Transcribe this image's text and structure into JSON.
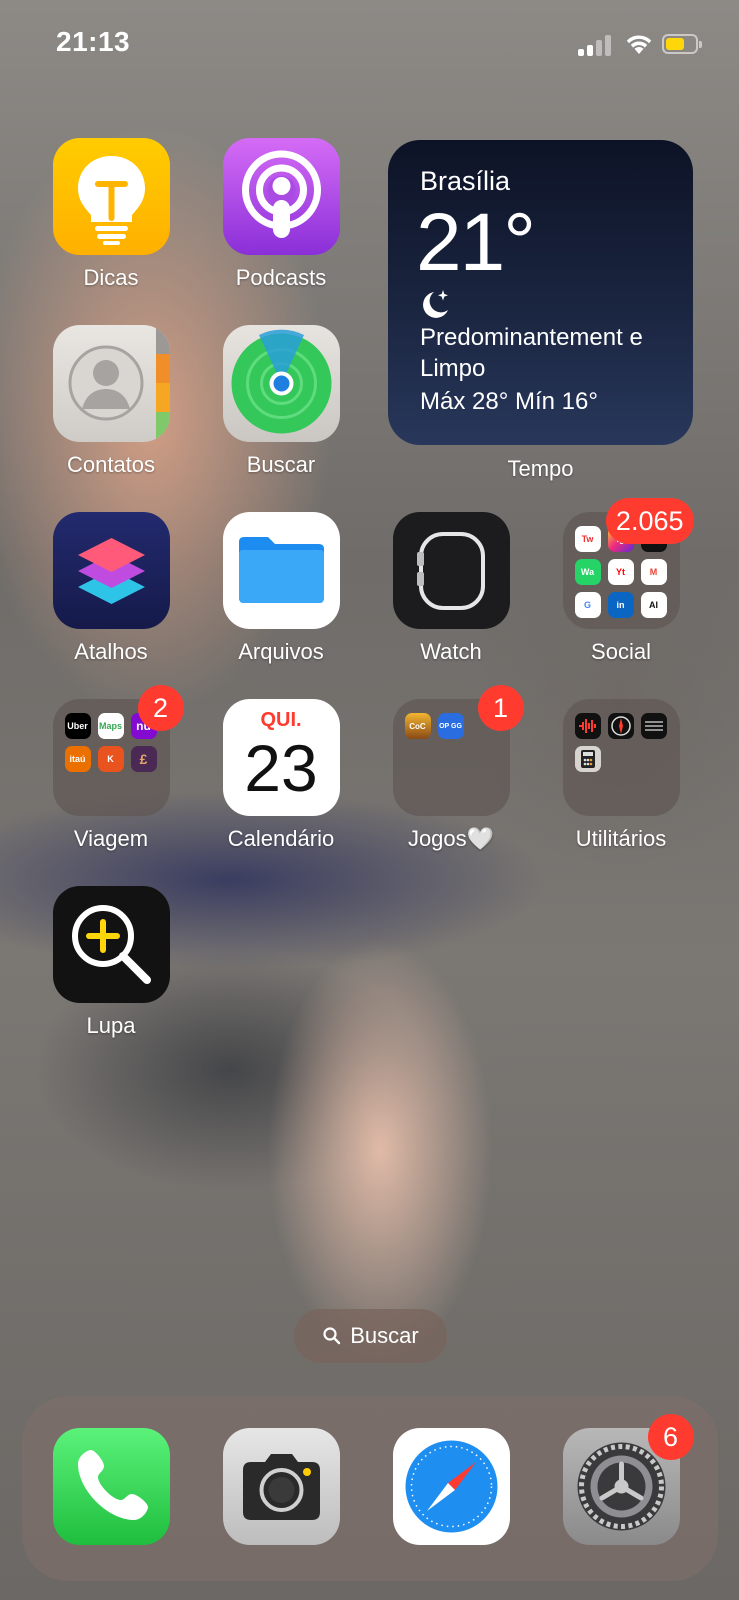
{
  "status_bar": {
    "time": "21:13",
    "battery_color": "#ffd60a",
    "battery_level": 0.65
  },
  "apps": [
    {
      "label": "Dicas",
      "icon": "lightbulb-icon"
    },
    {
      "label": "Podcasts",
      "icon": "podcasts-icon"
    },
    {
      "label": "Contatos",
      "icon": "contacts-icon"
    },
    {
      "label": "Buscar",
      "icon": "find-my-icon"
    },
    {
      "label": "Atalhos",
      "icon": "shortcuts-icon"
    },
    {
      "label": "Arquivos",
      "icon": "folder-icon"
    },
    {
      "label": "Watch",
      "icon": "watch-icon"
    },
    {
      "label": "Social",
      "icon": "folder-grid-icon",
      "badge": "2.065"
    },
    {
      "label": "Viagem",
      "icon": "folder-grid-icon",
      "badge": "2"
    },
    {
      "label": "Calendário",
      "icon": "calendar-icon",
      "weekday": "QUI.",
      "day": "23"
    },
    {
      "label": "Jogos🤍",
      "icon": "folder-grid-icon",
      "badge": "1"
    },
    {
      "label": "Utilitários",
      "icon": "folder-grid-icon"
    },
    {
      "label": "Lupa",
      "icon": "magnifier-icon"
    }
  ],
  "social_folder": [
    "Tw",
    "Ig",
    "Tk",
    "Wa",
    "Yt",
    "M",
    "G",
    "in",
    "AI"
  ],
  "viagem_folder": [
    "Uber",
    "Maps",
    "nu",
    "itaú",
    "K",
    "£"
  ],
  "jogos_folder": [
    "CoC",
    "OP GG"
  ],
  "weather_widget": {
    "label": "Tempo",
    "city": "Brasília",
    "temperature": "21°",
    "condition": "Predominantement e Limpo",
    "range": "Máx 28° Mín 16°"
  },
  "search_pill": {
    "label": "Buscar"
  },
  "dock": [
    {
      "name": "phone",
      "icon": "phone-icon"
    },
    {
      "name": "camera",
      "icon": "camera-icon"
    },
    {
      "name": "safari",
      "icon": "compass-icon"
    },
    {
      "name": "settings",
      "icon": "gear-icon",
      "badge": "6"
    }
  ]
}
